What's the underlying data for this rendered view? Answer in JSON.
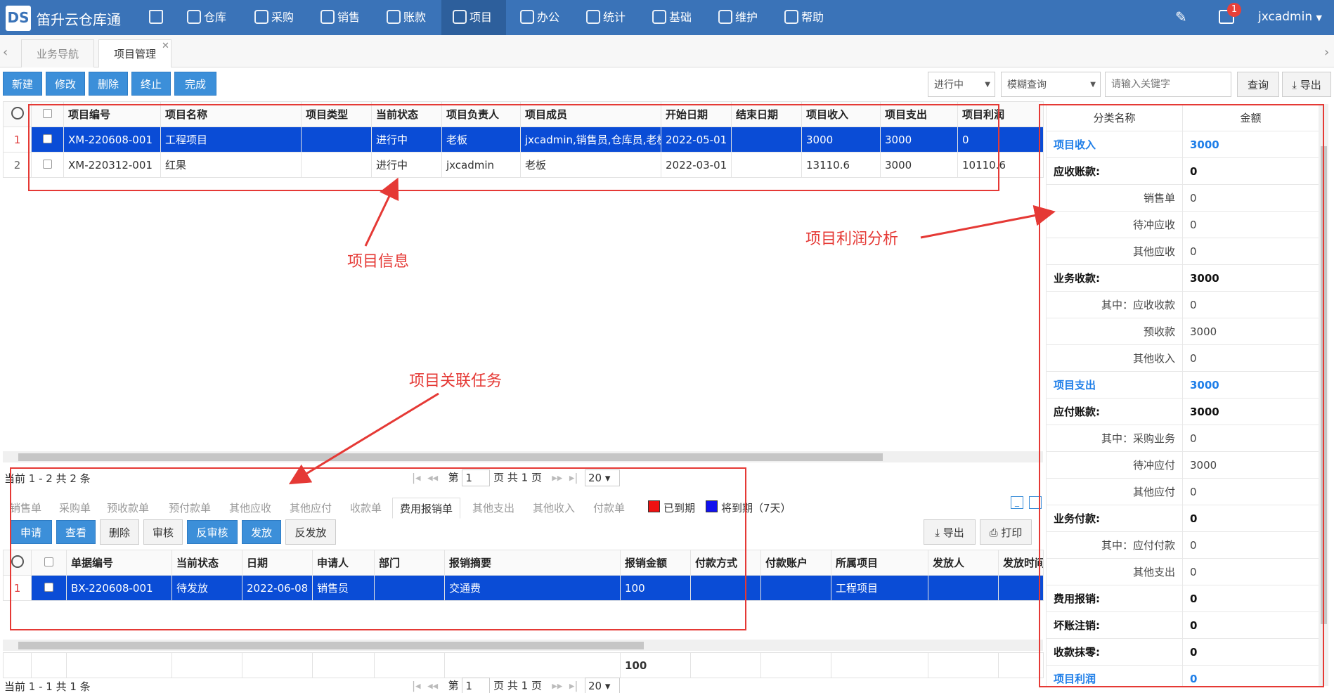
{
  "app": {
    "title": "笛升云仓库通",
    "logo_text": "DS",
    "user": "jxcadmin",
    "notif_count": "1"
  },
  "nav": [
    {
      "label": "",
      "icon": "home-icon"
    },
    {
      "label": "仓库",
      "icon": "warehouse-icon"
    },
    {
      "label": "采购",
      "icon": "purchase-icon"
    },
    {
      "label": "销售",
      "icon": "sales-icon"
    },
    {
      "label": "账款",
      "icon": "money-icon"
    },
    {
      "label": "项目",
      "icon": "project-icon"
    },
    {
      "label": "办公",
      "icon": "office-icon"
    },
    {
      "label": "统计",
      "icon": "chart-icon"
    },
    {
      "label": "基础",
      "icon": "gear-icon"
    },
    {
      "label": "维护",
      "icon": "maintain-icon"
    },
    {
      "label": "帮助",
      "icon": "help-icon"
    }
  ],
  "tabs": {
    "nav": "业务导航",
    "project": "项目管理"
  },
  "toolbar": {
    "new": "新建",
    "edit": "修改",
    "delete": "删除",
    "stop": "终止",
    "done": "完成",
    "status_select": "进行中",
    "mode_select": "模糊查询",
    "search_placeholder": "请输入关键字",
    "query": "查询",
    "export": "导出"
  },
  "project_table": {
    "headers": [
      "项目编号",
      "项目名称",
      "项目类型",
      "当前状态",
      "项目负责人",
      "项目成员",
      "开始日期",
      "结束日期",
      "项目收入",
      "项目支出",
      "项目利润"
    ],
    "rows": [
      [
        "1",
        "XM-220608-001",
        "工程项目",
        "",
        "进行中",
        "老板",
        "jxcadmin,销售员,仓库员,老板",
        "2022-05-01",
        "",
        "3000",
        "3000",
        "0"
      ],
      [
        "2",
        "XM-220312-001",
        "红果",
        "",
        "进行中",
        "jxcadmin",
        "老板",
        "2022-03-01",
        "",
        "13110.6",
        "3000",
        "10110.6"
      ]
    ]
  },
  "pager_top": {
    "summary": "当前 1 - 2 共 2 条",
    "page_prefix": "第",
    "page": "1",
    "page_suffix": "页 共 1 页",
    "size": "20"
  },
  "subtabs": [
    "销售单",
    "采购单",
    "预收款单",
    "预付款单",
    "其他应收",
    "其他应付",
    "收款单",
    "费用报销单",
    "其他支出",
    "其他收入",
    "付款单"
  ],
  "legend": {
    "expired": "已到期",
    "due": "将到期（7天）",
    "expired_color": "#ee1111",
    "due_color": "#1111ee"
  },
  "sub_toolbar": {
    "apply": "申请",
    "view": "查看",
    "delete": "删除",
    "audit": "审核",
    "unaudit": "反审核",
    "issue": "发放",
    "unissue": "反发放",
    "export": "导出",
    "print": "打印"
  },
  "expense_table": {
    "headers": [
      "单据编号",
      "当前状态",
      "日期",
      "申请人",
      "部门",
      "报销摘要",
      "报销金额",
      "付款方式",
      "付款账户",
      "所属项目",
      "发放人",
      "发放时间"
    ],
    "rows": [
      [
        "1",
        "BX-220608-001",
        "待发放",
        "2022-06-08",
        "销售员",
        "",
        "交通费",
        "100",
        "",
        "",
        "工程项目",
        "",
        ""
      ]
    ],
    "total": "100"
  },
  "pager_bottom": {
    "summary": "当前 1 - 1 共 1 条",
    "page_prefix": "第",
    "page": "1",
    "page_suffix": "页 共 1 页",
    "size": "20"
  },
  "profit": {
    "headers": [
      "分类名称",
      "金额"
    ],
    "rows": [
      {
        "k": "项目收入",
        "v": "3000",
        "t": "h"
      },
      {
        "k": "应收账款:",
        "v": "0",
        "t": "b"
      },
      {
        "k": "销售单",
        "v": "0",
        "t": "s"
      },
      {
        "k": "待冲应收",
        "v": "0",
        "t": "s"
      },
      {
        "k": "其他应收",
        "v": "0",
        "t": "s"
      },
      {
        "k": "业务收款:",
        "v": "3000",
        "t": "b"
      },
      {
        "k": "其中：应收收款",
        "v": "0",
        "t": "s"
      },
      {
        "k": "预收款",
        "v": "3000",
        "t": "s"
      },
      {
        "k": "其他收入",
        "v": "0",
        "t": "s"
      },
      {
        "k": "项目支出",
        "v": "3000",
        "t": "h"
      },
      {
        "k": "应付账款:",
        "v": "3000",
        "t": "b"
      },
      {
        "k": "其中：采购业务",
        "v": "0",
        "t": "s"
      },
      {
        "k": "待冲应付",
        "v": "3000",
        "t": "s"
      },
      {
        "k": "其他应付",
        "v": "0",
        "t": "s"
      },
      {
        "k": "业务付款:",
        "v": "0",
        "t": "b"
      },
      {
        "k": "其中：应付付款",
        "v": "0",
        "t": "s"
      },
      {
        "k": "其他支出",
        "v": "0",
        "t": "s"
      },
      {
        "k": "费用报销:",
        "v": "0",
        "t": "b"
      },
      {
        "k": "坏账注销:",
        "v": "0",
        "t": "b"
      },
      {
        "k": "收款抹零:",
        "v": "0",
        "t": "b"
      },
      {
        "k": "项目利润",
        "v": "0",
        "t": "h"
      }
    ]
  },
  "annotations": {
    "project_info": "项目信息",
    "profit_analysis": "项目利润分析",
    "related_tasks": "项目关联任务"
  }
}
